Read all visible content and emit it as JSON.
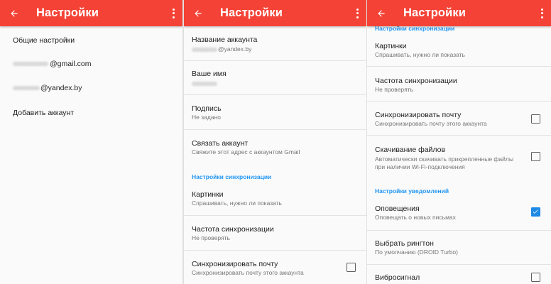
{
  "app": {
    "title": "Настройки"
  },
  "panel1": {
    "items": [
      {
        "label": "Общие настройки"
      },
      {
        "label": "@gmail.com"
      },
      {
        "label": "@yandex.by"
      },
      {
        "label": "Добавить аккаунт"
      }
    ]
  },
  "panel2": {
    "account": {
      "title": "Название аккаунта",
      "value": "@yandex.by"
    },
    "name": {
      "title": "Ваше имя"
    },
    "signature": {
      "title": "Подпись",
      "value": "Не задано"
    },
    "link": {
      "title": "Связать аккаунт",
      "value": "Свяжите этот адрес с аккаунтом Gmail"
    },
    "sync_header": "Настройки синхронизации",
    "images": {
      "title": "Картинки",
      "value": "Спрашивать, нужно ли показать"
    },
    "freq": {
      "title": "Частота синхронизации",
      "value": "Не проверять"
    },
    "syncmail": {
      "title": "Синхронизировать почту",
      "value": "Синхронизировать почту этого аккаунта",
      "checked": false
    }
  },
  "panel3": {
    "sync_header": "Настройки синхронизации",
    "images": {
      "title": "Картинки",
      "value": "Спрашивать, нужно ли показать"
    },
    "freq": {
      "title": "Частота синхронизации",
      "value": "Не проверять"
    },
    "syncmail": {
      "title": "Синхронизировать почту",
      "value": "Синхронизировать почту этого аккаунта",
      "checked": false
    },
    "download": {
      "title": "Скачивание файлов",
      "value": "Автоматически скачивать прикрепленные файлы при наличии Wi-Fi-подключения",
      "checked": false
    },
    "notif_header": "Настройки уведомлений",
    "alerts": {
      "title": "Оповещения",
      "value": "Оповещать о новых письмах",
      "checked": true
    },
    "ringtone": {
      "title": "Выбрать рингтон",
      "value": "По умолчанию (DROID Turbo)"
    },
    "vibrate": {
      "title": "Вибросигнал",
      "checked": false
    }
  },
  "colors": {
    "appbar": "#f44336",
    "accent": "#2196f3",
    "checkbox_on": "#1e88e5"
  },
  "icons": {
    "back": "arrow-back-icon",
    "menu": "more-vert-icon"
  }
}
